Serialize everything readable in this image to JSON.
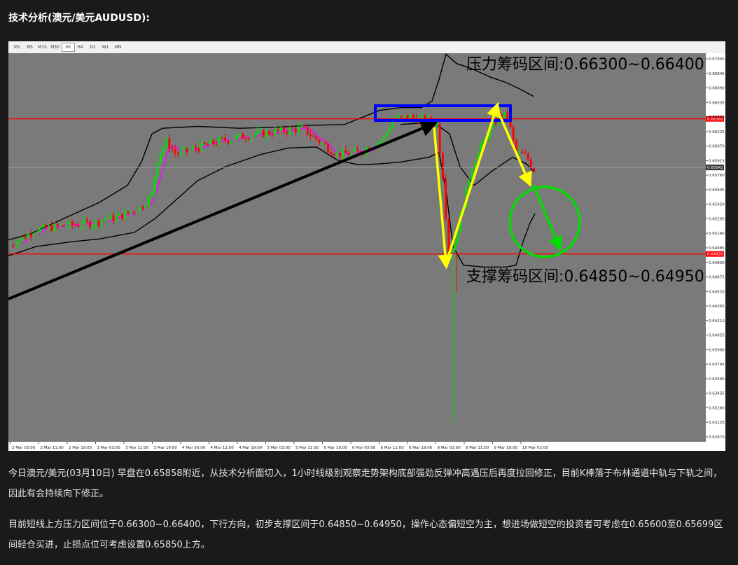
{
  "title": "技术分析(澳元/美元AUDUSD):",
  "timeframes": [
    "M1",
    "M5",
    "M15",
    "M30",
    "H1",
    "H4",
    "D1",
    "W1",
    "MN"
  ],
  "active_timeframe": "H1",
  "paragraphs": [
    "今日澳元/美元(03月10日) 早盘在0.65858附近，从技术分析面切入，1小时线级别观察走势架构底部强劲反弹冲高遇压后再度拉回修正，目前K棒落于布林通道中轨与下轨之间，因此有会持续向下修正。",
    "目前短线上方压力区间位于0.66300~0.66400，下行方向，初步支撑区间于0.64850~0.64950，操作心态偏短空为主，想进场做短空的投资者可考虑在0.65600至0.65699区间轻仓买进，止损点位可考虑设置0.65850上方。"
  ],
  "chart_data": {
    "type": "candlestick",
    "instrument": "AUDUSD",
    "timeframe": "H1",
    "y_ticks": [
      "0.67000",
      "0.66845",
      "0.66690",
      "0.66535",
      "0.66380",
      "0.66225",
      "0.66070",
      "0.65915",
      "0.65760",
      "0.65605",
      "0.65450",
      "0.65295",
      "0.65140",
      "0.64985",
      "0.64830",
      "0.64675",
      "0.64520",
      "0.64365",
      "0.64210",
      "0.64055",
      "0.63900",
      "0.63745",
      "0.63590",
      "0.63435",
      "0.63280",
      "0.63125",
      "0.62970"
    ],
    "ylim": [
      0.6297,
      0.67
    ],
    "x_ticks": [
      "2 Mar 03:00",
      "2 Mar 11:00",
      "2 Mar 19:00",
      "3 Mar 03:00",
      "3 Mar 11:00",
      "3 Mar 19:00",
      "4 Mar 03:00",
      "4 Mar 11:00",
      "4 Mar 19:00",
      "5 Mar 03:00",
      "5 Mar 11:00",
      "5 Mar 19:00",
      "6 Mar 03:00",
      "6 Mar 11:00",
      "6 Mar 19:00",
      "9 Mar 03:00",
      "9 Mar 11:00",
      "9 Mar 19:00",
      "10 Mar 03:00"
    ],
    "horizontal_lines": [
      {
        "value": 0.6636,
        "label": "0.66360",
        "color": "#ff0000"
      },
      {
        "value": 0.6492,
        "label": "0.64920",
        "color": "#ff0000"
      }
    ],
    "current_price": {
      "value": 0.65842,
      "label": "0.65842"
    },
    "annotations": {
      "resistance": "压力筹码区间:0.66300~0.66400",
      "support": "支撑筹码区间:0.64850~0.64950"
    },
    "colors": {
      "background": "#7a7a7a",
      "bull": "#00e000",
      "bear": "#ff0000",
      "middle_band": "#ff00ff",
      "bands": "#000000",
      "trend_arrow": "#000000",
      "path_arrows": "#ffff00",
      "box": "#0000ff",
      "circle": "#00dd00",
      "level_line": "#ff0000"
    }
  }
}
